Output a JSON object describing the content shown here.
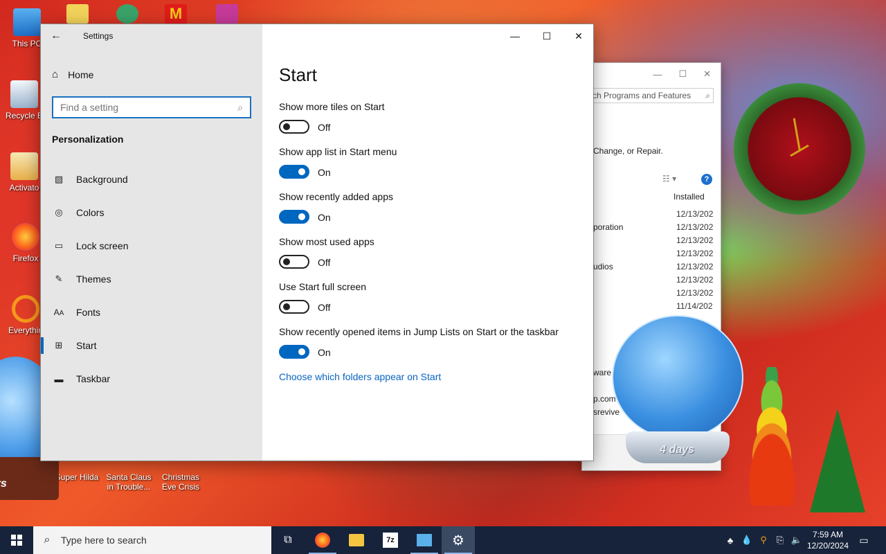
{
  "desktop": {
    "icons": [
      {
        "label": "This PC"
      },
      {
        "label": "Recycle B"
      },
      {
        "label": "Activato"
      },
      {
        "label": "Firefox"
      },
      {
        "label": "Everythin"
      },
      {
        "label": "Super Hilda"
      },
      {
        "label": "Santa Claus in Trouble..."
      },
      {
        "label": "Christmas Eve Crisis"
      }
    ],
    "globe_countdown": "4 days",
    "left_badge": "ys"
  },
  "background_window": {
    "search_text": "ch Programs and Features",
    "description": "Change, or Repair.",
    "column_header": "Installed",
    "rows": [
      {
        "name": "",
        "date": "12/13/202"
      },
      {
        "name": "poration",
        "date": "12/13/202"
      },
      {
        "name": "",
        "date": "12/13/202"
      },
      {
        "name": "",
        "date": "12/13/202"
      },
      {
        "name": "udios",
        "date": "12/13/202"
      },
      {
        "name": "",
        "date": "12/13/202"
      },
      {
        "name": "",
        "date": "12/13/202"
      },
      {
        "name": "",
        "date": "11/14/202"
      }
    ],
    "trailing": [
      "ware",
      "p.com",
      "srevive",
      "etsrevive"
    ]
  },
  "settings": {
    "window_title": "Settings",
    "home_label": "Home",
    "search_placeholder": "Find a setting",
    "section_title": "Personalization",
    "nav": [
      {
        "label": "Background",
        "icon": "picture-icon"
      },
      {
        "label": "Colors",
        "icon": "palette-icon"
      },
      {
        "label": "Lock screen",
        "icon": "lock-screen-icon"
      },
      {
        "label": "Themes",
        "icon": "brush-icon"
      },
      {
        "label": "Fonts",
        "icon": "font-icon"
      },
      {
        "label": "Start",
        "icon": "start-layout-icon",
        "active": true
      },
      {
        "label": "Taskbar",
        "icon": "taskbar-icon"
      }
    ],
    "page_title": "Start",
    "options": [
      {
        "label": "Show more tiles on Start",
        "state": "Off"
      },
      {
        "label": "Show app list in Start menu",
        "state": "On"
      },
      {
        "label": "Show recently added apps",
        "state": "On"
      },
      {
        "label": "Show most used apps",
        "state": "Off"
      },
      {
        "label": "Use Start full screen",
        "state": "Off"
      },
      {
        "label": "Show recently opened items in Jump Lists on Start or the taskbar",
        "state": "On"
      }
    ],
    "folders_link": "Choose which folders appear on Start"
  },
  "taskbar": {
    "search_placeholder": "Type here to search",
    "apps": [
      "task-view-icon",
      "firefox-icon",
      "file-explorer-icon",
      "7zip-icon",
      "control-panel-icon",
      "settings-gear-icon"
    ],
    "time": "7:59 AM",
    "date": "12/20/2024"
  },
  "colors": {
    "accent": "#0067c0",
    "link": "#0a64c2",
    "taskbar": "#16233a",
    "sidebar": "#e6e6e6"
  }
}
